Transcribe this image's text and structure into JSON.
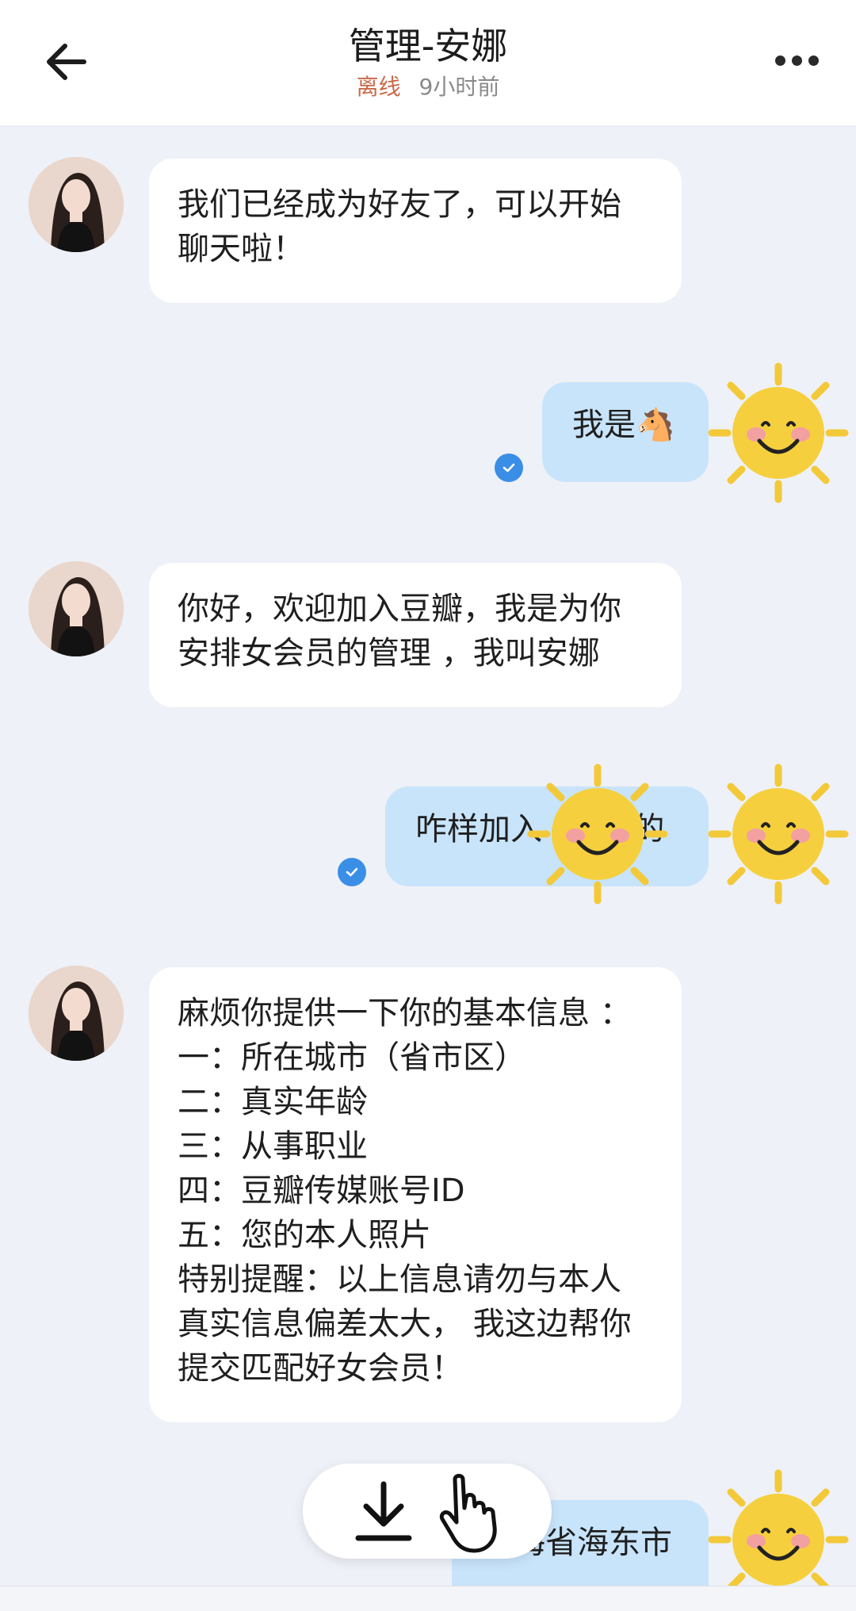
{
  "header": {
    "title": "管理-安娜",
    "status": "离线",
    "last_seen": "9小时前",
    "back_icon": "arrow-left-icon",
    "more_icon": "more-dots-icon"
  },
  "messages": [
    {
      "from": "contact",
      "text": "我们已经成为好友了，可以开始\n聊天啦！"
    },
    {
      "from": "me",
      "text": "我是🐴",
      "read": true
    },
    {
      "from": "contact",
      "text": "你好，欢迎加入豆瓣，我是为你\n安排女会员的管理 ，我叫安娜"
    },
    {
      "from": "me",
      "text": "咋样加入         的",
      "read": true
    },
    {
      "from": "contact",
      "text": "麻烦你提供一下你的基本信息 ：\n一：所在城市（省市区）\n二：真实年龄\n三：从事职业\n四：豆瓣传媒账号ID\n五：您的本人照片\n特别提醒：以上信息请勿与本人\n真实信息偏差太大， 我这边帮你\n提交匹配好女会员！"
    },
    {
      "from": "me",
      "text": "青海省海东市"
    }
  ],
  "floating_actions": {
    "download_icon": "download-icon",
    "hand_icon": "pointing-hand-icon"
  },
  "colors": {
    "page_bg": "#eef1f7",
    "incoming_bubble": "#ffffff",
    "outgoing_bubble": "#c8e4fb",
    "status_offline": "#c96a4a",
    "read_check": "#3a8ee6"
  }
}
